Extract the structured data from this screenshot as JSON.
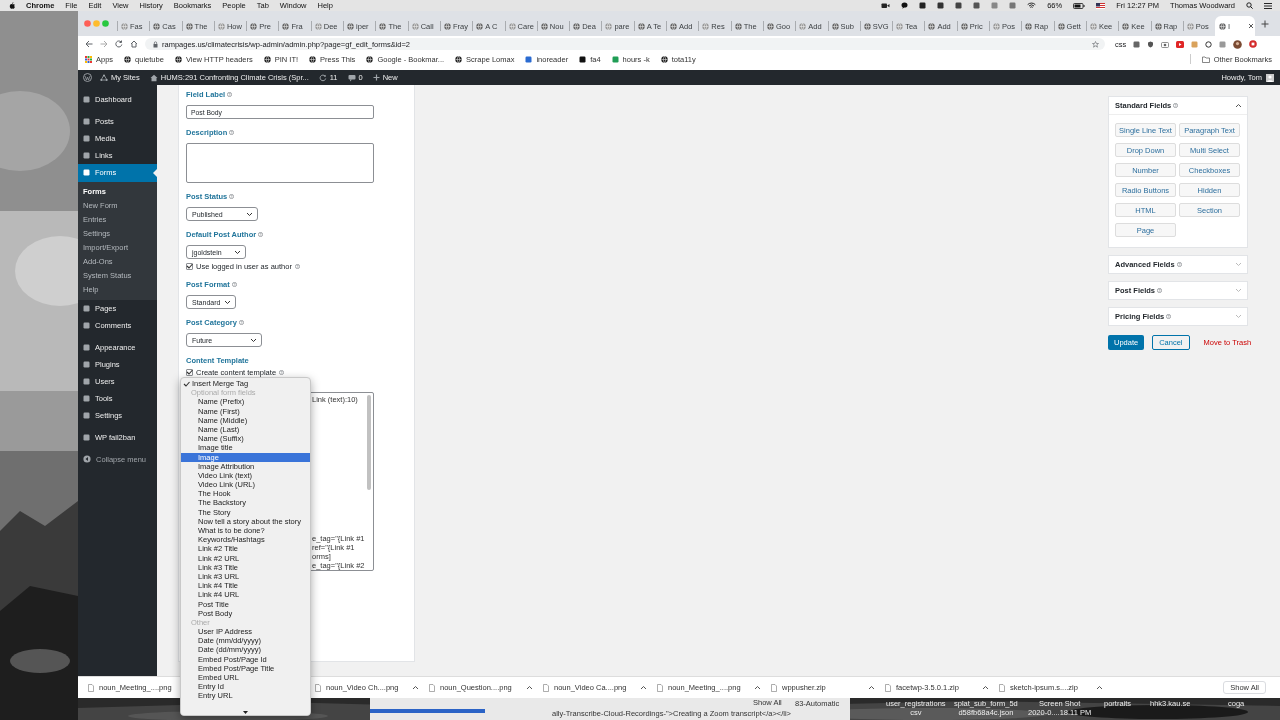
{
  "menubar": {
    "app": "Chrome",
    "menus": [
      "File",
      "Edit",
      "View",
      "History",
      "Bookmarks",
      "People",
      "Tab",
      "Window",
      "Help"
    ],
    "battery": "66%",
    "clock": "Fri 12:27 PM",
    "user": "Thomas Woodward"
  },
  "tabs": [
    {
      "title": "Fas",
      "selected": false
    },
    {
      "title": "Cas",
      "selected": false
    },
    {
      "title": "The",
      "selected": false
    },
    {
      "title": "How",
      "selected": false
    },
    {
      "title": "Pre",
      "selected": false
    },
    {
      "title": "Fra",
      "selected": false
    },
    {
      "title": "Dee",
      "selected": false
    },
    {
      "title": "iper",
      "selected": false
    },
    {
      "title": "The",
      "selected": false
    },
    {
      "title": "Call",
      "selected": false
    },
    {
      "title": "Fray",
      "selected": false
    },
    {
      "title": "A C",
      "selected": false
    },
    {
      "title": "Care",
      "selected": false
    },
    {
      "title": "Nou",
      "selected": false
    },
    {
      "title": "Dea",
      "selected": false
    },
    {
      "title": "pare",
      "selected": false
    },
    {
      "title": "A Te",
      "selected": false
    },
    {
      "title": "Add",
      "selected": false
    },
    {
      "title": "Res",
      "selected": false
    },
    {
      "title": "The",
      "selected": false
    },
    {
      "title": "Goo",
      "selected": false
    },
    {
      "title": "Add",
      "selected": false
    },
    {
      "title": "Sub",
      "selected": false
    },
    {
      "title": "SVG",
      "selected": false
    },
    {
      "title": "Tea",
      "selected": false
    },
    {
      "title": "Add",
      "selected": false
    },
    {
      "title": "Pric",
      "selected": false
    },
    {
      "title": "Pos",
      "selected": false
    },
    {
      "title": "Rap",
      "selected": false
    },
    {
      "title": "Gett",
      "selected": false
    },
    {
      "title": "Kee",
      "selected": false
    },
    {
      "title": "Kee",
      "selected": false
    },
    {
      "title": "Rap",
      "selected": false
    },
    {
      "title": "Pos",
      "selected": false
    },
    {
      "title": "I",
      "selected": true
    }
  ],
  "toolbar": {
    "url": "rampages.us/climatecrisis/wp-admin/admin.php?page=gf_edit_forms&id=2",
    "extension": "css"
  },
  "bookmarks": [
    "Apps",
    "quietube",
    "View HTTP headers",
    "PIN IT!",
    "Press This",
    "Google - Bookmar...",
    "Scrape Lomax",
    "inoreader",
    "fa4",
    "hours -k",
    "tota11y"
  ],
  "other_bookmarks": "Other Bookmarks",
  "admin_bar": {
    "my_sites": "My Sites",
    "site": "HUMS:291 Confronting Climate Crisis (Spr...",
    "updates": "11",
    "comments": "0",
    "new": "New",
    "howdy": "Howdy, Tom"
  },
  "sidebar": {
    "groups": [
      {
        "items": [
          {
            "label": "Dashboard",
            "selected": false
          }
        ]
      },
      {
        "items": [
          {
            "label": "Posts",
            "selected": false
          },
          {
            "label": "Media",
            "selected": false
          },
          {
            "label": "Links",
            "selected": false
          },
          {
            "label": "Forms",
            "selected": true,
            "children": [
              {
                "label": "Forms",
                "selected": true
              },
              {
                "label": "New Form",
                "selected": false
              },
              {
                "label": "Entries",
                "selected": false
              },
              {
                "label": "Settings",
                "selected": false
              },
              {
                "label": "Import/Export",
                "selected": false
              },
              {
                "label": "Add-Ons",
                "selected": false
              },
              {
                "label": "System Status",
                "selected": false
              },
              {
                "label": "Help",
                "selected": false
              }
            ]
          },
          {
            "label": "Pages",
            "selected": false
          },
          {
            "label": "Comments",
            "selected": false
          }
        ]
      },
      {
        "items": [
          {
            "label": "Appearance",
            "selected": false
          },
          {
            "label": "Plugins",
            "selected": false
          },
          {
            "label": "Users",
            "selected": false
          },
          {
            "label": "Tools",
            "selected": false
          },
          {
            "label": "Settings",
            "selected": false
          }
        ]
      },
      {
        "items": [
          {
            "label": "WP fail2ban",
            "selected": false
          }
        ]
      }
    ],
    "collapse": "Collapse menu"
  },
  "form": {
    "fields": [
      {
        "kind": "text",
        "label": "Field Label",
        "help": true,
        "value": "Post Body"
      },
      {
        "kind": "textarea",
        "label": "Description",
        "help": true
      },
      {
        "kind": "select",
        "label": "Post Status",
        "help": true,
        "value": "Published"
      },
      {
        "kind": "select",
        "label": "Default Post Author",
        "help": true,
        "value": "jgoldstein",
        "checkbox": {
          "label": "Use logged in user as author",
          "checked": true,
          "help": true
        }
      },
      {
        "kind": "select",
        "label": "Post Format",
        "help": true,
        "value": "Standard"
      },
      {
        "kind": "select",
        "label": "Post Category",
        "help": true,
        "value": "Future"
      },
      {
        "kind": "template",
        "label": "Content Template",
        "help": false,
        "checkbox": {
          "label": "Create content template",
          "checked": true,
          "help": true
        },
        "text_top": [
          "Link (text):10)"
        ],
        "text_bottom": [
          "e_tag=\"{Link #1",
          "ref=\"{Link #1",
          "orms]",
          "e_tag=\"{Link #2"
        ]
      }
    ]
  },
  "merge_menu": {
    "items": [
      {
        "kind": "option",
        "label": "Insert Merge Tag",
        "checked": true,
        "highlighted": false
      },
      {
        "kind": "group",
        "label": "Optional form fields"
      },
      {
        "kind": "option",
        "label": "Name (Prefix)",
        "checked": false,
        "highlighted": false
      },
      {
        "kind": "option",
        "label": "Name (First)",
        "checked": false,
        "highlighted": false
      },
      {
        "kind": "option",
        "label": "Name (Middle)",
        "checked": false,
        "highlighted": false
      },
      {
        "kind": "option",
        "label": "Name (Last)",
        "checked": false,
        "highlighted": false
      },
      {
        "kind": "option",
        "label": "Name (Suffix)",
        "checked": false,
        "highlighted": false
      },
      {
        "kind": "option",
        "label": "Image title",
        "checked": false,
        "highlighted": false
      },
      {
        "kind": "option",
        "label": "Image",
        "checked": false,
        "highlighted": true
      },
      {
        "kind": "option",
        "label": "Image Attribution",
        "checked": false,
        "highlighted": false
      },
      {
        "kind": "option",
        "label": "Video Link (text)",
        "checked": false,
        "highlighted": false
      },
      {
        "kind": "option",
        "label": "Video Link (URL)",
        "checked": false,
        "highlighted": false
      },
      {
        "kind": "option",
        "label": "The Hook",
        "checked": false,
        "highlighted": false
      },
      {
        "kind": "option",
        "label": "The Backstory",
        "checked": false,
        "highlighted": false
      },
      {
        "kind": "option",
        "label": "The Story",
        "checked": false,
        "highlighted": false
      },
      {
        "kind": "option",
        "label": "Now tell a story about the story",
        "checked": false,
        "highlighted": false
      },
      {
        "kind": "option",
        "label": "What is to be done?",
        "checked": false,
        "highlighted": false
      },
      {
        "kind": "option",
        "label": "Keywords/Hashtags",
        "checked": false,
        "highlighted": false
      },
      {
        "kind": "option",
        "label": "Link #2 Title",
        "checked": false,
        "highlighted": false
      },
      {
        "kind": "option",
        "label": "Link #2 URL",
        "checked": false,
        "highlighted": false
      },
      {
        "kind": "option",
        "label": "Link #3 Title",
        "checked": false,
        "highlighted": false
      },
      {
        "kind": "option",
        "label": "Link #3 URL",
        "checked": false,
        "highlighted": false
      },
      {
        "kind": "option",
        "label": "Link #4 Title",
        "checked": false,
        "highlighted": false
      },
      {
        "kind": "option",
        "label": "Link #4 URL",
        "checked": false,
        "highlighted": false
      },
      {
        "kind": "option",
        "label": "Post Title",
        "checked": false,
        "highlighted": false
      },
      {
        "kind": "option",
        "label": "Post Body",
        "checked": false,
        "highlighted": false
      },
      {
        "kind": "group",
        "label": "Other"
      },
      {
        "kind": "option",
        "label": "User IP Address",
        "checked": false,
        "highlighted": false
      },
      {
        "kind": "option",
        "label": "Date (mm/dd/yyyy)",
        "checked": false,
        "highlighted": false
      },
      {
        "kind": "option",
        "label": "Date (dd/mm/yyyy)",
        "checked": false,
        "highlighted": false
      },
      {
        "kind": "option",
        "label": "Embed Post/Page Id",
        "checked": false,
        "highlighted": false
      },
      {
        "kind": "option",
        "label": "Embed Post/Page Title",
        "checked": false,
        "highlighted": false
      },
      {
        "kind": "option",
        "label": "Embed URL",
        "checked": false,
        "highlighted": false
      },
      {
        "kind": "option",
        "label": "Entry Id",
        "checked": false,
        "highlighted": false
      },
      {
        "kind": "option",
        "label": "Entry URL",
        "checked": false,
        "highlighted": false
      }
    ]
  },
  "panel": {
    "groups": [
      {
        "title": "Standard Fields",
        "expanded": true,
        "buttons": [
          "Single Line Text",
          "Paragraph Text",
          "Drop Down",
          "Multi Select",
          "Number",
          "Checkboxes",
          "Radio Buttons",
          "Hidden",
          "HTML",
          "Section",
          "Page"
        ]
      },
      {
        "title": "Advanced Fields",
        "expanded": false
      },
      {
        "title": "Post Fields",
        "expanded": false
      },
      {
        "title": "Pricing Fields",
        "expanded": false
      }
    ],
    "update": "Update",
    "cancel": "Cancel",
    "trash": "Move to Trash"
  },
  "downloads": {
    "items": [
      "noun_Meeting_....png",
      "noun_Video Ch....png",
      "noun_Question....png",
      "noun_Video Ca....png",
      "noun_Meeting_....png",
      "wppusher.zip",
      "facetwp-3.5.0.1.zip",
      "sketch-ipsum.s....zip"
    ],
    "show_all": "Show All"
  },
  "desktop": {
    "icons": [
      {
        "lines": [
          "user_registrations",
          "csv"
        ]
      },
      {
        "lines": [
          "splat_sub_form_5d",
          "d58fb68a4c.json"
        ]
      },
      {
        "lines": [
          "Screen Shot",
          "2020-0....18.11 PM"
        ]
      },
      {
        "lines": [
          "portraits"
        ]
      },
      {
        "lines": [
          "hhk3.kau.se"
        ]
      },
      {
        "lines": [
          "coga"
        ]
      }
    ],
    "window_texts": [
      "Show All",
      "83-Automatic",
      "ally-Transcribe-Cloud-Recordings-\">Creating a Zoom transcript</a></li>"
    ]
  }
}
